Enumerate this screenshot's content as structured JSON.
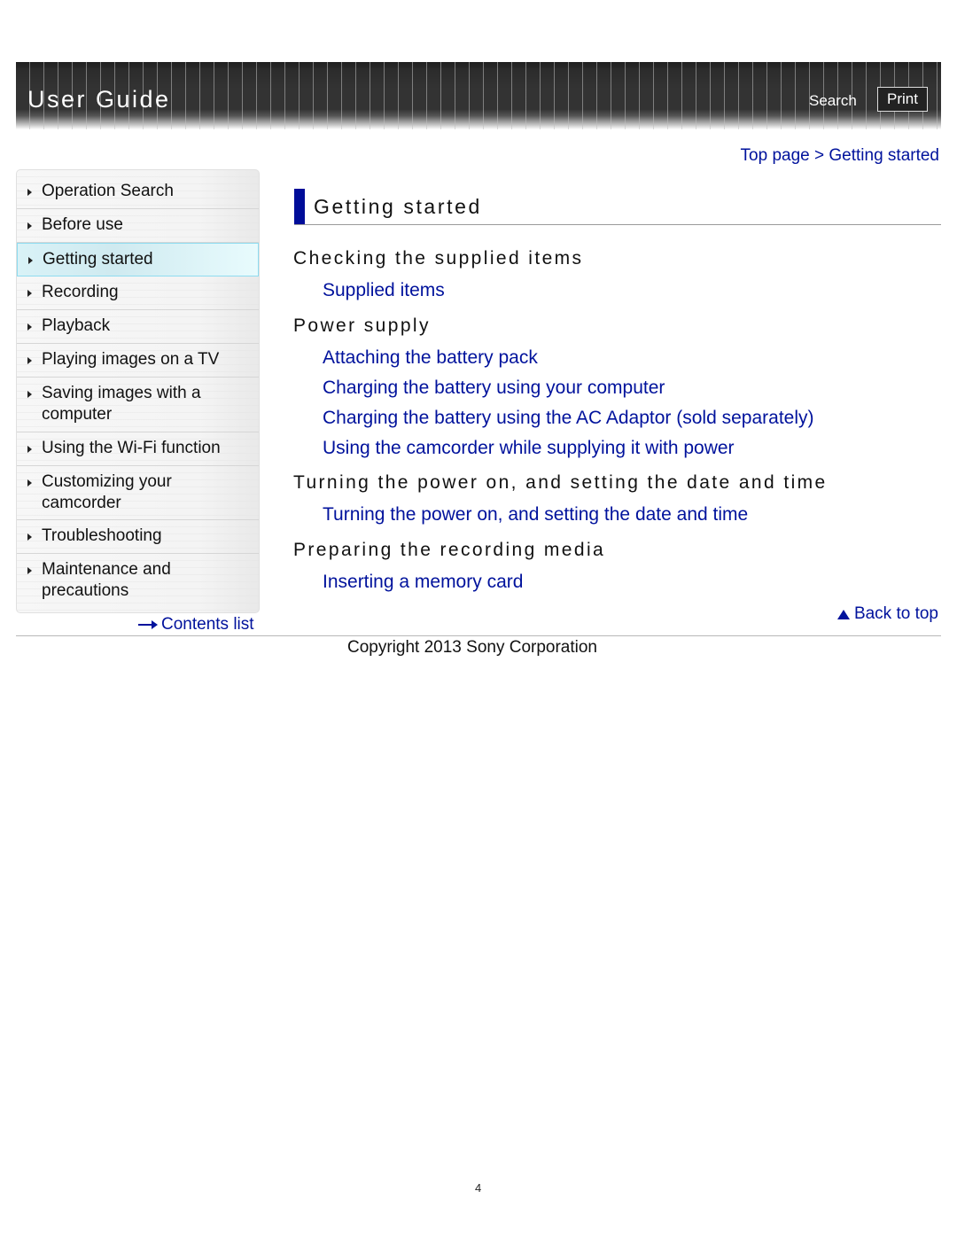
{
  "header": {
    "title": "User Guide",
    "search_label": "Search",
    "print_label": "Print"
  },
  "breadcrumb": {
    "items": [
      "Top page",
      "Getting started"
    ],
    "separator": ">"
  },
  "sidebar": {
    "items": [
      {
        "label": "Operation Search",
        "active": false
      },
      {
        "label": "Before use",
        "active": false
      },
      {
        "label": "Getting started",
        "active": true
      },
      {
        "label": "Recording",
        "active": false
      },
      {
        "label": "Playback",
        "active": false
      },
      {
        "label": "Playing images on a TV",
        "active": false
      },
      {
        "label": "Saving images with a computer",
        "active": false
      },
      {
        "label": "Using the Wi-Fi function",
        "active": false
      },
      {
        "label": "Customizing your camcorder",
        "active": false
      },
      {
        "label": "Troubleshooting",
        "active": false
      },
      {
        "label": "Maintenance and precautions",
        "active": false
      }
    ],
    "contents_link": "Contents list"
  },
  "main": {
    "title": "Getting started",
    "sections": [
      {
        "heading": "Checking the supplied items",
        "links": [
          "Supplied items"
        ]
      },
      {
        "heading": "Power supply",
        "links": [
          "Attaching the battery pack",
          "Charging the battery using your computer",
          "Charging the battery using the AC Adaptor (sold separately)",
          "Using the camcorder while supplying it with power"
        ]
      },
      {
        "heading": "Turning the power on, and setting the date and time",
        "links": [
          "Turning the power on, and setting the date and time"
        ]
      },
      {
        "heading": "Preparing the recording media",
        "links": [
          "Inserting a memory card"
        ]
      }
    ],
    "back_to_top": "Back to top"
  },
  "footer": {
    "copyright": "Copyright 2013 Sony Corporation",
    "page_number": "4"
  },
  "colors": {
    "link": "#00129c",
    "title_accent": "#000d99",
    "active_nav": "#d9f2f7",
    "header_bg": "#333333"
  }
}
